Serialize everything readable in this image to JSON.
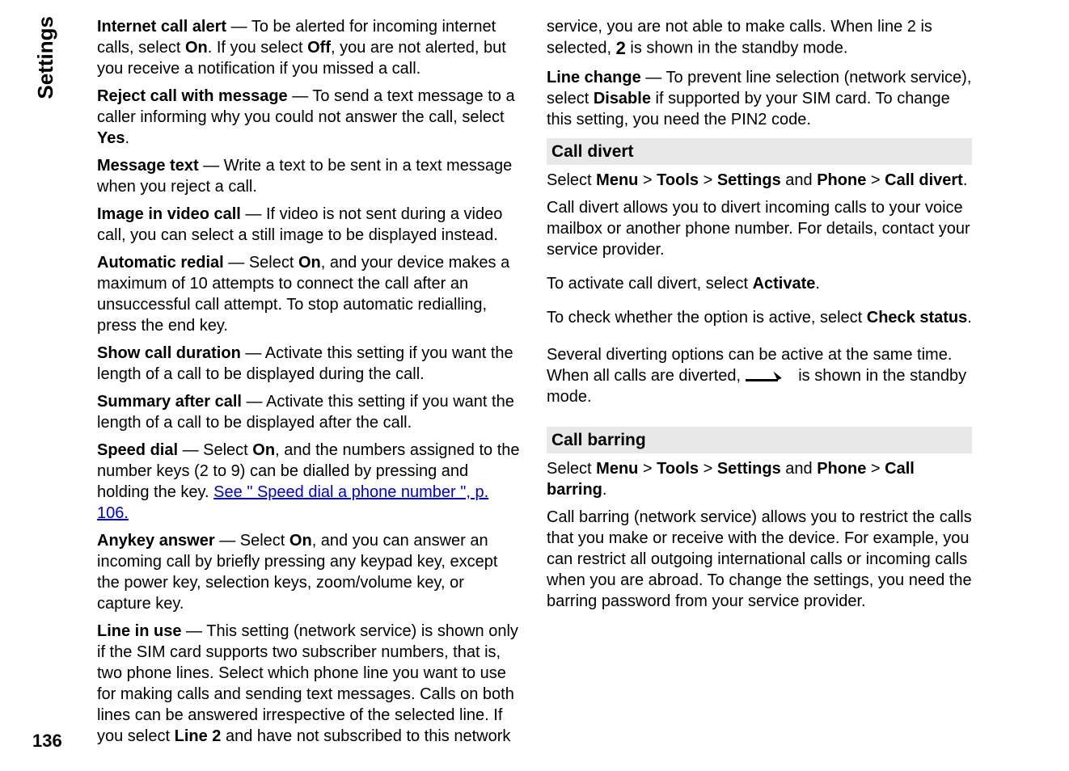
{
  "sidebar": {
    "label": "Settings",
    "page_number": "136"
  },
  "col1": {
    "p1_b": "Internet call alert",
    "p1_a": "  — To be alerted for incoming internet calls, select ",
    "p1_b2": "On",
    "p1_c": ". If you select ",
    "p1_b3": "Off",
    "p1_d": ", you are not alerted, but you receive a notification if you missed a call.",
    "p2_b": "Reject call with message",
    "p2_a": "  — To send a text message to a caller informing why you could not answer the call, select ",
    "p2_b2": "Yes",
    "p2_c": ".",
    "p3_b": "Message text",
    "p3_a": "  — Write a text to be sent in a text message when you reject a call.",
    "p4_b": "Image in video call",
    "p4_a": "  — If video is not sent during a video call, you can select a still image to be displayed instead.",
    "p5_b": "Automatic redial",
    "p5_a": "  — Select ",
    "p5_b2": "On",
    "p5_c": ", and your device makes a maximum of 10 attempts to connect the call after an unsuccessful call attempt. To stop automatic redialling, press the end key.",
    "p6_b": "Show call duration",
    "p6_a": "  — Activate this setting if you want the length of a call to be displayed during the call.",
    "p7_b": "Summary after call",
    "p7_a": "  — Activate this setting if you want the length of a call to be displayed after the call.",
    "p8_b": "Speed dial",
    "p8_a": "  — Select ",
    "p8_b2": "On",
    "p8_c": ", and the numbers assigned to the number keys (2 to 9) can be dialled by pressing and holding the key. ",
    "p8_link": "See \" Speed dial a phone number \", p. 106.",
    "p9_b": "Anykey answer",
    "p9_a": "  — Select ",
    "p9_b2": "On",
    "p9_c": ", and you can answer an incoming call by briefly pressing any keypad key, except the power key, selection keys, zoom/volume key, or capture key.",
    "p10_b": "Line in use",
    "p10_a": "  — This setting (network service) is shown only if the SIM card supports two subscriber numbers, that is, two phone lines. Select which phone line you want to use for making calls and sending text messages. Calls on both lines can be answered irrespective of the selected line. If you select ",
    "p10_b2": "Line 2",
    "p10_c": " and have not subscribed to this network"
  },
  "col2": {
    "p1_a": "service, you are not able to make calls. When line 2 is selected, ",
    "p1_icon": "2",
    "p1_b": " is shown in the standby mode.",
    "p2_b": "Line change",
    "p2_a": "  — To prevent line selection (network service), select ",
    "p2_b2": "Disable",
    "p2_c": " if supported by your SIM card. To change this setting, you need the PIN2 code.",
    "h1": "Call divert",
    "p3_a": "Select ",
    "p3_b1": "Menu",
    "p3_s1": " > ",
    "p3_b2": "Tools",
    "p3_s2": " > ",
    "p3_b3": "Settings",
    "p3_s3": " and ",
    "p3_b4": "Phone",
    "p3_s4": " > ",
    "p3_b5": "Call divert",
    "p3_end": ".",
    "p4": "Call divert allows you to divert incoming calls to your voice mailbox or another phone number. For details, contact your service provider.",
    "p5_a": "To activate call divert, select ",
    "p5_b": "Activate",
    "p5_c": ".",
    "p6_a": "To check whether the option is active, select ",
    "p6_b": "Check status",
    "p6_c": ".",
    "p7_a": "Several diverting options can be active at the same time. When all calls are diverted, ",
    "p7_b": " is shown in the standby mode.",
    "h2": "Call barring",
    "p8_a": "Select ",
    "p8_b1": "Menu",
    "p8_s1": " > ",
    "p8_b2": "Tools",
    "p8_s2": " > ",
    "p8_b3": "Settings",
    "p8_s3": " and ",
    "p8_b4": "Phone",
    "p8_s4": " > ",
    "p8_b5": "Call barring",
    "p8_end": ".",
    "p9": "Call barring (network service) allows you to restrict the calls that you make or receive with the device. For example, you can restrict all outgoing international calls or incoming calls when you are abroad. To change the settings, you need the barring password from your service provider."
  }
}
